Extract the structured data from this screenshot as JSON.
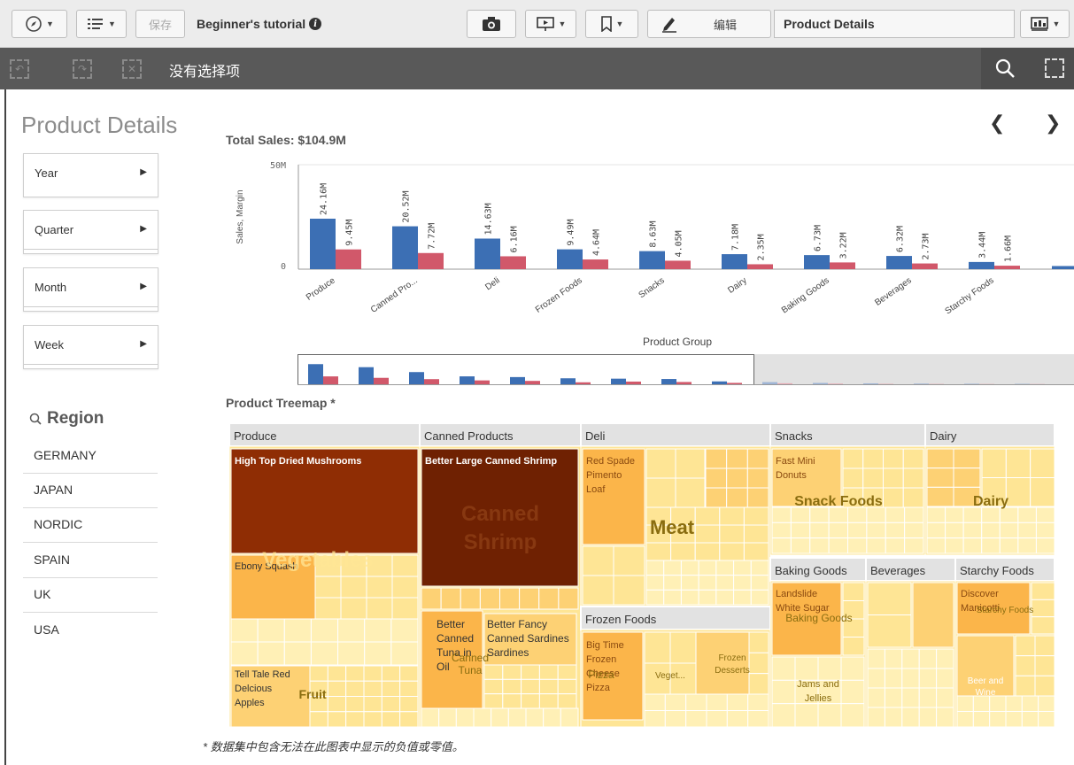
{
  "toolbar": {
    "save_label": "保存",
    "app_title": "Beginner's tutorial",
    "edit_label": "编辑",
    "sheet_name": "Product Details"
  },
  "selection_bar": {
    "text": "没有选择项"
  },
  "sheet": {
    "title": "Product Details",
    "filters": [
      "Year",
      "Quarter",
      "Month",
      "Week"
    ],
    "region": {
      "title": "Region",
      "items": [
        "GERMANY",
        "JAPAN",
        "NORDIC",
        "SPAIN",
        "UK",
        "USA"
      ]
    },
    "footnote": "* 数据集中包含无法在此图表中显示的负值或零值。"
  },
  "chart_data": [
    {
      "type": "bar",
      "title": "Total Sales: $104.9M",
      "xlabel": "Product Group",
      "ylabel": "Sales, Margin",
      "ylim": [
        0,
        50
      ],
      "y_unit": "M",
      "yticks": [
        "50M",
        "0"
      ],
      "categories": [
        "Produce",
        "Canned Pro...",
        "Deli",
        "Frozen Foods",
        "Snacks",
        "Dairy",
        "Baking Goods",
        "Beverages",
        "Starchy Foods"
      ],
      "series": [
        {
          "name": "Sales",
          "color": "#3c6fb4",
          "values": [
            24.16,
            20.52,
            14.63,
            9.49,
            8.63,
            7.18,
            6.73,
            6.32,
            3.44
          ],
          "labels": [
            "24.16M",
            "20.52M",
            "14.63M",
            "9.49M",
            "8.63M",
            "7.18M",
            "6.73M",
            "6.32M",
            "3.44M"
          ]
        },
        {
          "name": "Margin",
          "color": "#d1586a",
          "values": [
            9.45,
            7.72,
            6.16,
            4.64,
            4.05,
            2.35,
            3.22,
            2.73,
            1.66
          ],
          "labels": [
            "9.45M",
            "7.72M",
            "6.16M",
            "4.64M",
            "4.05M",
            "2.35M",
            "3.22M",
            "2.73M",
            "1.66M"
          ]
        }
      ]
    },
    {
      "type": "treemap",
      "title": "Product Treemap *",
      "groups": [
        {
          "name": "Produce",
          "subgroups": [
            "Vegetables",
            "Fruit"
          ],
          "items": [
            "High Top Dried Mushrooms",
            "Ebony Squash",
            "Tell Tale Red Delcious Apples"
          ]
        },
        {
          "name": "Canned Products",
          "subgroups": [
            "Canned Shrimp",
            "Canned Tuna",
            "Canned Sardines"
          ],
          "items": [
            "Better Large Canned Shrimp",
            "Better Canned Tuna in Oil",
            "Better Fancy Canned Sardines"
          ]
        },
        {
          "name": "Deli",
          "subgroups": [
            "Meat"
          ],
          "items": [
            "Red Spade Pimento Loaf"
          ]
        },
        {
          "name": "Frozen Foods",
          "subgroups": [
            "Pizza",
            "Veget...",
            "Frozen Desserts"
          ],
          "items": [
            "Big Time Frozen Cheese Pizza"
          ]
        },
        {
          "name": "Snacks",
          "subgroups": [
            "Snack Foods"
          ],
          "items": [
            "Fast Mini Donuts"
          ]
        },
        {
          "name": "Dairy",
          "subgroups": [
            "Dairy"
          ],
          "items": []
        },
        {
          "name": "Baking Goods",
          "subgroups": [
            "Baking Goods",
            "Jams and Jellies"
          ],
          "items": [
            "Landslide White Sugar"
          ]
        },
        {
          "name": "Beverages",
          "subgroups": [],
          "items": []
        },
        {
          "name": "Starchy Foods",
          "subgroups": [
            "Starchy Foods",
            "Beer and Wine"
          ],
          "items": [
            "Discover Manicotti"
          ]
        }
      ]
    }
  ]
}
